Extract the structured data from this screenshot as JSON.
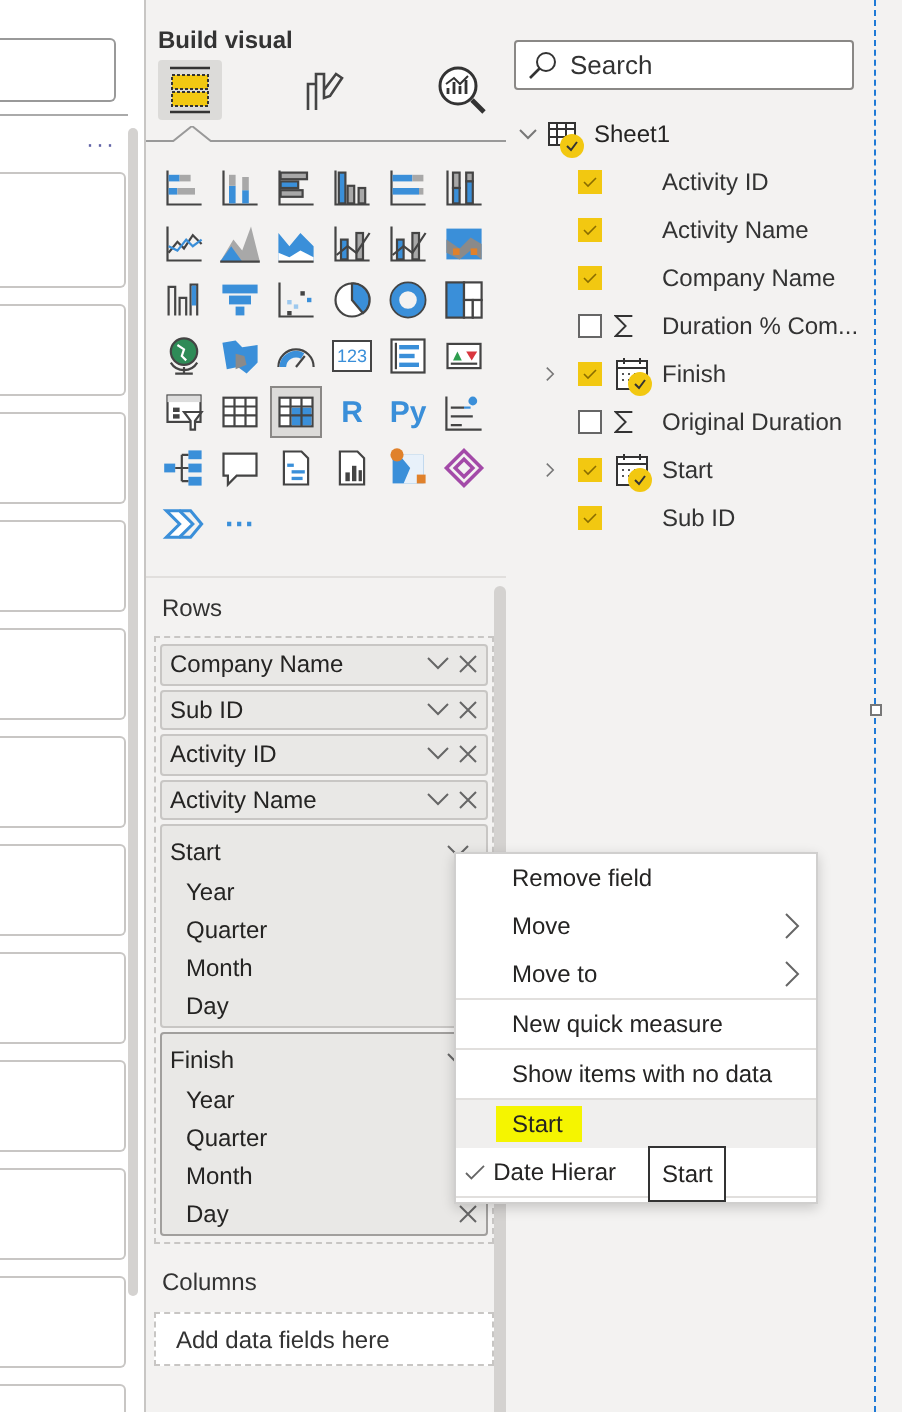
{
  "left_pane": {
    "more": "···"
  },
  "visualizations": {
    "title": "Build visual",
    "tabs": [
      {
        "kind": "fields",
        "selected": true
      },
      {
        "kind": "format",
        "selected": false
      },
      {
        "kind": "analytics",
        "selected": false
      }
    ],
    "gallery": [
      {
        "kind": "stacked-bar",
        "selected": false
      },
      {
        "kind": "stacked-column",
        "selected": false
      },
      {
        "kind": "clustered-bar",
        "selected": false
      },
      {
        "kind": "clustered-column",
        "selected": false
      },
      {
        "kind": "bar100",
        "selected": false
      },
      {
        "kind": "column100",
        "selected": false
      },
      {
        "kind": "line",
        "selected": false
      },
      {
        "kind": "area",
        "selected": false
      },
      {
        "kind": "stacked-area",
        "selected": false
      },
      {
        "kind": "line-column",
        "selected": false
      },
      {
        "kind": "line-column",
        "selected": false
      },
      {
        "kind": "ribbon",
        "selected": false
      },
      {
        "kind": "waterfall",
        "selected": false
      },
      {
        "kind": "funnel",
        "selected": false
      },
      {
        "kind": "scatter",
        "selected": false
      },
      {
        "kind": "pie",
        "selected": false
      },
      {
        "kind": "donut",
        "selected": false
      },
      {
        "kind": "treemap",
        "selected": false
      },
      {
        "kind": "globe",
        "selected": false
      },
      {
        "kind": "filled-map",
        "selected": false
      },
      {
        "kind": "gauge",
        "selected": false
      },
      {
        "kind": "card",
        "label": "123",
        "selected": false
      },
      {
        "kind": "multirow-card",
        "selected": false
      },
      {
        "kind": "kpi",
        "selected": false
      },
      {
        "kind": "slicer",
        "selected": false
      },
      {
        "kind": "table",
        "selected": false
      },
      {
        "kind": "matrix",
        "selected": true
      },
      {
        "kind": "text",
        "label": "R",
        "selected": false
      },
      {
        "kind": "text",
        "label": "Py",
        "selected": false
      },
      {
        "kind": "key-influencers",
        "selected": false
      },
      {
        "kind": "decomposition-tree",
        "selected": false
      },
      {
        "kind": "qa",
        "selected": false
      },
      {
        "kind": "paginated",
        "selected": false
      },
      {
        "kind": "report",
        "selected": false
      },
      {
        "kind": "arcgis",
        "selected": false
      },
      {
        "kind": "power-apps",
        "selected": false
      },
      {
        "kind": "power-automate",
        "selected": false
      },
      {
        "kind": "text",
        "label": "···",
        "selected": false
      }
    ]
  },
  "rows_well": {
    "title": "Rows",
    "fields": [
      {
        "label": "Company Name",
        "kind": "field"
      },
      {
        "label": "Sub ID",
        "kind": "field"
      },
      {
        "label": "Activity ID",
        "kind": "field"
      },
      {
        "label": "Activity Name",
        "kind": "field"
      },
      {
        "label": "Start",
        "kind": "hierarchy",
        "hovered": false,
        "levels": [
          "Year",
          "Quarter",
          "Month",
          "Day"
        ]
      },
      {
        "label": "Finish",
        "kind": "hierarchy",
        "hovered": true,
        "levels": [
          "Year",
          "Quarter",
          "Month",
          "Day"
        ]
      }
    ]
  },
  "columns_well": {
    "title": "Columns",
    "placeholder": "Add data fields here"
  },
  "data_pane": {
    "search": {
      "placeholder": "Search"
    },
    "tree": [
      {
        "name": "Sheet1",
        "expanded": true,
        "in_use": true,
        "children": [
          {
            "name": "Activity ID",
            "kind": "text",
            "checked": true
          },
          {
            "name": "Activity Name",
            "kind": "text",
            "checked": true
          },
          {
            "name": "Company Name",
            "kind": "text",
            "checked": true
          },
          {
            "name": "Duration % Com...",
            "kind": "sum",
            "checked": false
          },
          {
            "name": "Finish",
            "kind": "date",
            "checked": true,
            "expanded": false
          },
          {
            "name": "Original Duration",
            "kind": "sum",
            "checked": false
          },
          {
            "name": "Start",
            "kind": "date",
            "checked": true,
            "expanded": false
          },
          {
            "name": "Sub ID",
            "kind": "text",
            "checked": true
          }
        ]
      }
    ]
  },
  "context_menu": {
    "groups": [
      [
        {
          "label": "Remove field",
          "submenu": false,
          "checked": false,
          "selected": false,
          "highlighted": false
        },
        {
          "label": "Move",
          "submenu": true,
          "checked": false,
          "selected": false,
          "highlighted": false
        },
        {
          "label": "Move to",
          "submenu": true,
          "checked": false,
          "selected": false,
          "highlighted": false
        }
      ],
      [
        {
          "label": "New quick measure",
          "submenu": false,
          "checked": false,
          "selected": false,
          "highlighted": false
        }
      ],
      [
        {
          "label": "Show items with no data",
          "submenu": false,
          "checked": false,
          "selected": false,
          "highlighted": false
        }
      ],
      [
        {
          "label": "Start",
          "submenu": false,
          "checked": false,
          "selected": true,
          "highlighted": true
        },
        {
          "label": "Date Hierar",
          "submenu": false,
          "checked": true,
          "selected": false,
          "highlighted": false
        }
      ]
    ],
    "tooltip": "Start"
  }
}
